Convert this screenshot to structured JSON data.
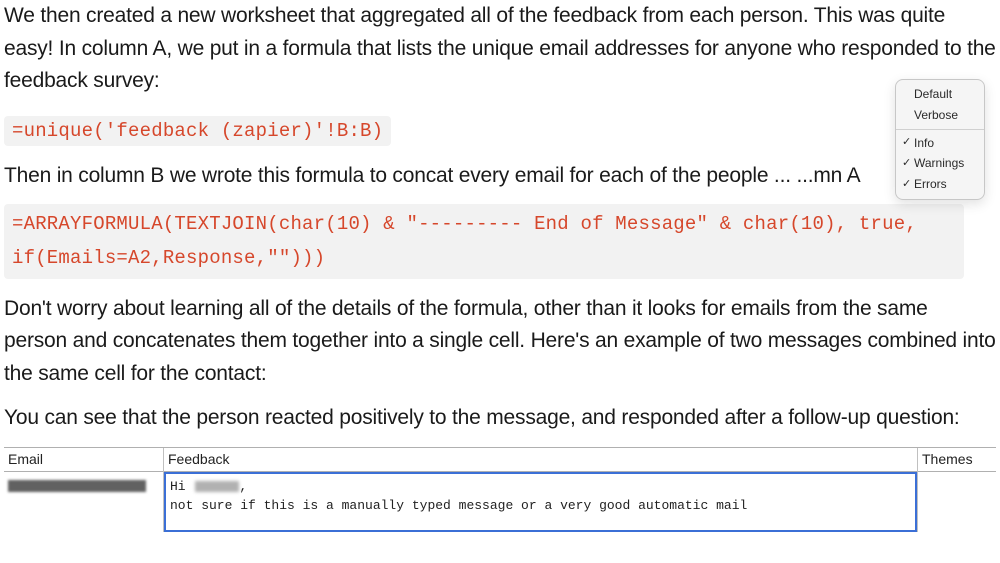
{
  "paragraphs": {
    "p1": "We then created a new worksheet that aggregated all of the feedback from each person. This was quite easy! In column A, we put in a formula that lists the unique email addresses for anyone who responded to the feedback survey:",
    "p2": "Then in column B we wrote this formula to concat every email for each of the people ... ...mn A",
    "p3": "Don't worry about learning all of the details of the formula, other than it looks for emails from the same person and concatenates them together into a single cell. Here's an example of two messages combined into the same cell for the contact:",
    "p4": "You can see that the person reacted positively to the message, and responded after a follow-up question:"
  },
  "code": {
    "formula1": "=unique('feedback (zapier)'!B:B)",
    "formula2_line1": "=ARRAYFORMULA(TEXTJOIN(char(10) & \"--------- End of Message\" & char(10), true,",
    "formula2_line2": "if(Emails=A2,Response,\"\")))"
  },
  "menu": {
    "default": "Default",
    "verbose": "Verbose",
    "info": "Info",
    "warnings": "Warnings",
    "errors": "Errors",
    "check": "✓"
  },
  "table": {
    "headers": {
      "email": "Email",
      "feedback": "Feedback",
      "themes": "Themes"
    },
    "feedback": {
      "greeting_prefix": "Hi ",
      "greeting_suffix": ",",
      "line2": "not sure if this is a manually typed message or a very good automatic mail"
    }
  }
}
